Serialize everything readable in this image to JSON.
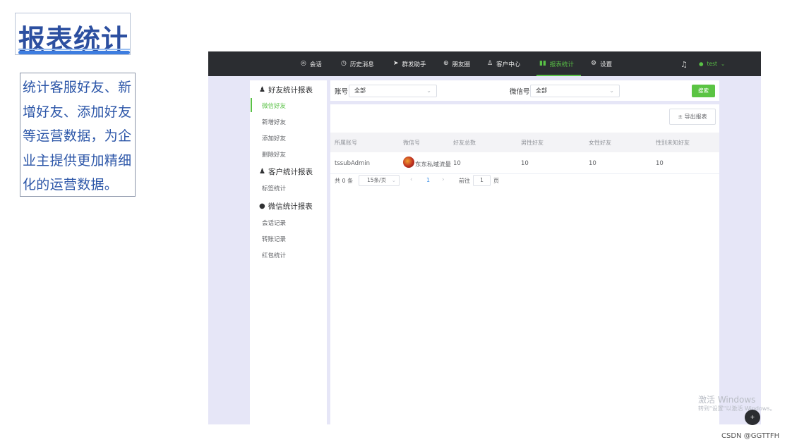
{
  "slide": {
    "title": "报表统计",
    "description": "统计客服好友、新增好友、添加好友等运营数据，为企业主提供更加精细化的运营数据。"
  },
  "topnav": {
    "items": [
      {
        "label": "会话",
        "icon": "chat-icon"
      },
      {
        "label": "历史消息",
        "icon": "clock-icon"
      },
      {
        "label": "群发助手",
        "icon": "send-icon"
      },
      {
        "label": "朋友圈",
        "icon": "moments-icon"
      },
      {
        "label": "客户中心",
        "icon": "user-icon"
      },
      {
        "label": "报表统计",
        "icon": "bar-chart-icon",
        "active": true
      },
      {
        "label": "设置",
        "icon": "gear-icon"
      }
    ],
    "user": "test"
  },
  "sidebar": {
    "groups": [
      {
        "title": "好友统计报表",
        "icon": "user-icon",
        "items": [
          "微信好友",
          "新增好友",
          "添加好友",
          "删除好友"
        ]
      },
      {
        "title": "客户统计报表",
        "icon": "user-icon",
        "items": [
          "标签统计"
        ]
      },
      {
        "title": "微信统计报表",
        "icon": "wechat-icon",
        "items": [
          "会话记录",
          "转账记录",
          "红包统计"
        ]
      }
    ],
    "active_item": "微信好友"
  },
  "filters": {
    "account_label": "账号",
    "account_value": "全部",
    "wechat_label": "微信号",
    "wechat_value": "全部",
    "search_label": "搜索"
  },
  "toolbar": {
    "export_label": "± 导出报表"
  },
  "table": {
    "columns": [
      "所属账号",
      "微信号",
      "好友总数",
      "男性好友",
      "女性好友",
      "性别未知好友"
    ],
    "rows": [
      [
        "tssubAdmin",
        "东东私域流量",
        "10",
        "10",
        "10",
        "10"
      ]
    ]
  },
  "pagination": {
    "total": "共 0 条",
    "page_size": "15条/页",
    "current_page": "1",
    "goto_label": "前往",
    "goto_value": "1",
    "page_suffix": "页"
  },
  "watermark": {
    "line1": "激活 Windows",
    "line2": "转到\"设置\"以激活 Windows。"
  },
  "credit": "CSDN @GGTTFH",
  "colors": {
    "accent_green": "#59c146",
    "nav_bg": "#2b2d31",
    "title_blue": "#2c4fa0"
  }
}
